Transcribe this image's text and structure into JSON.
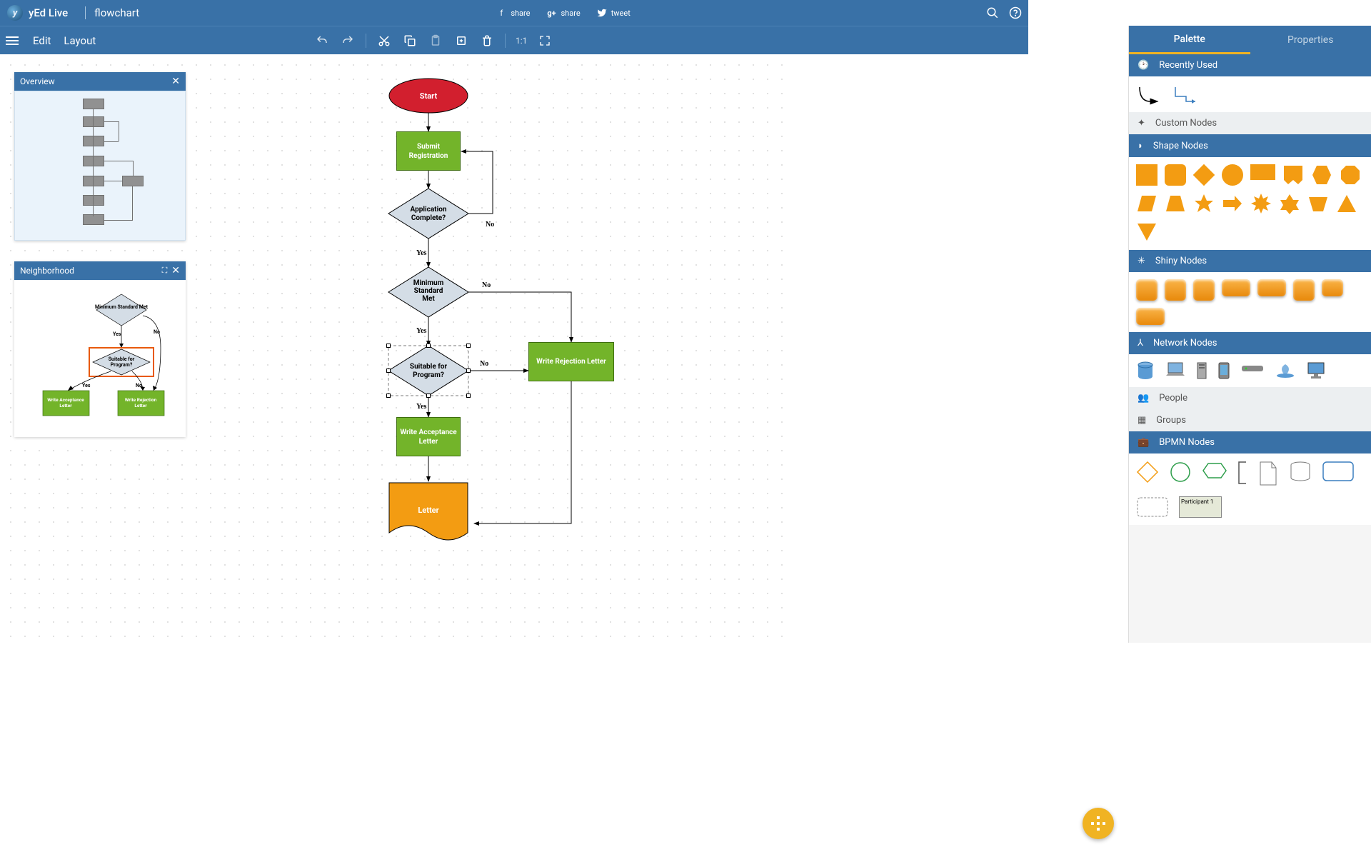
{
  "app": {
    "name": "yEd Live",
    "document": "flowchart"
  },
  "share": {
    "fb": "share",
    "gp": "share",
    "tw": "tweet"
  },
  "menu": {
    "edit": "Edit",
    "layout": "Layout",
    "ratio": "1:1"
  },
  "panels": {
    "overview": "Overview",
    "neighborhood": "Neighborhood"
  },
  "flow": {
    "start": "Start",
    "submit": "Submit Registration",
    "app_complete": "Application Complete?",
    "min_std": "Minimum Standard Met",
    "suitable": "Suitable for Program?",
    "write_accept": "Write Acceptance Letter",
    "write_reject": "Write Rejection Letter",
    "letter": "Letter",
    "yes": "Yes",
    "no": "No"
  },
  "nb": {
    "min_std": "Minimum Standard Met",
    "suitable": "Suitable for Program?",
    "accept": "Write Acceptance Letter",
    "reject": "Write Rejection Letter",
    "yes": "Yes",
    "no": "No"
  },
  "sidebar": {
    "tabs": {
      "palette": "Palette",
      "properties": "Properties"
    },
    "cats": {
      "recent": "Recently Used",
      "custom": "Custom Nodes",
      "shape": "Shape Nodes",
      "shiny": "Shiny Nodes",
      "network": "Network Nodes",
      "people": "People",
      "groups": "Groups",
      "bpmn": "BPMN Nodes"
    },
    "bpmn_participant": "Participant 1"
  }
}
